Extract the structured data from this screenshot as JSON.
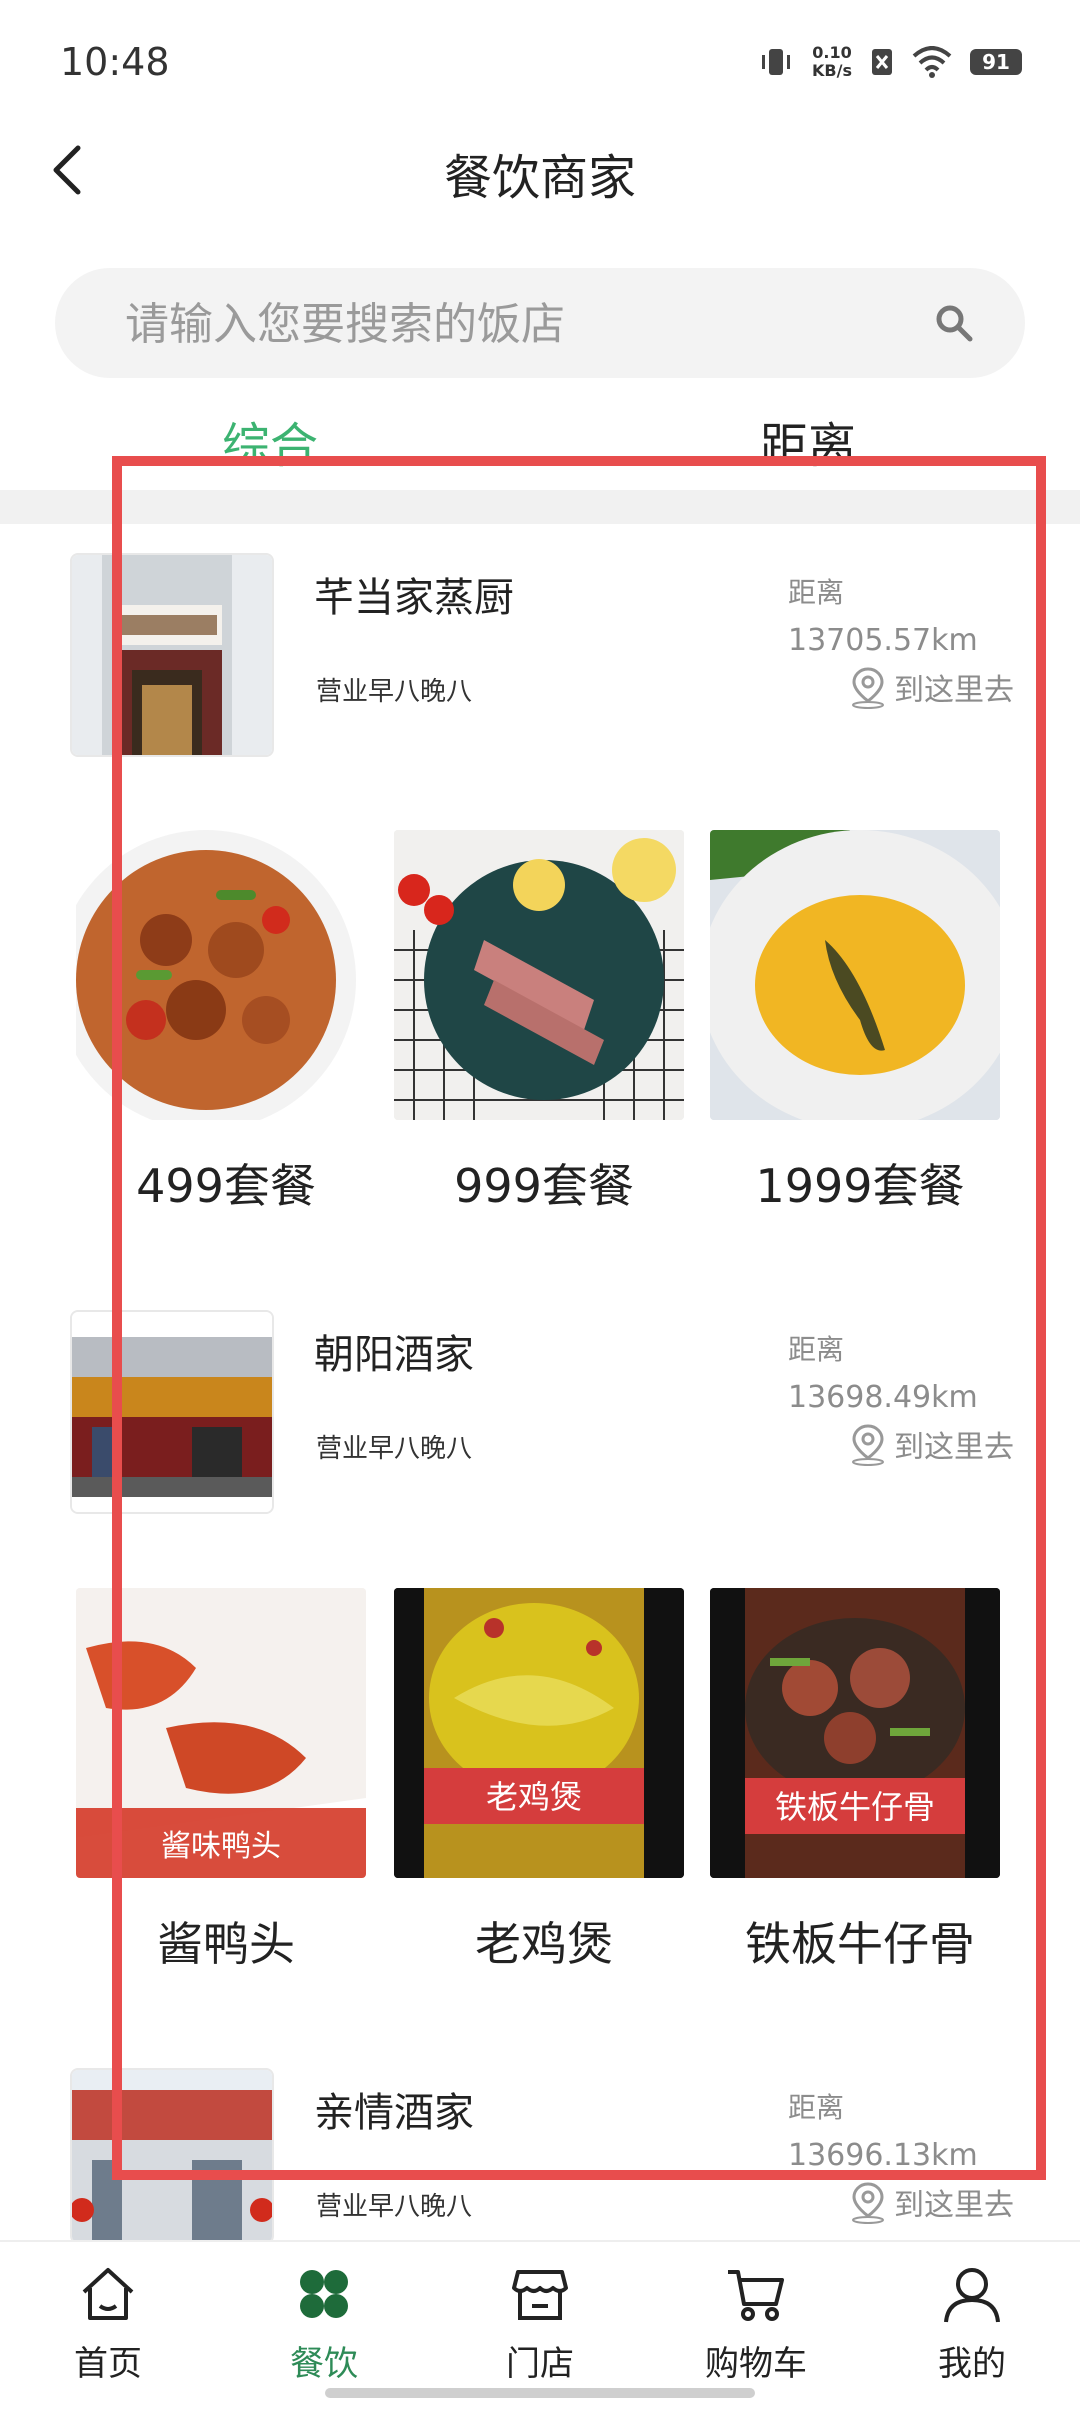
{
  "status": {
    "time": "10:48",
    "net_top": "0.10",
    "net_bottom": "KB/s",
    "battery": "91"
  },
  "header": {
    "title": "餐饮商家"
  },
  "search": {
    "placeholder": "请输入您要搜索的饭店"
  },
  "tabs": [
    {
      "label": "综合",
      "active": true
    },
    {
      "label": "距离",
      "active": false
    }
  ],
  "restaurants": [
    {
      "name": "芊当家蒸厨",
      "hours": "营业早八晚八",
      "distance_label": "距离",
      "distance": "13705.57km",
      "goto": "到这里去",
      "dishes": [
        {
          "name": "499套餐"
        },
        {
          "name": "999套餐"
        },
        {
          "name": "1999套餐"
        }
      ]
    },
    {
      "name": "朝阳酒家",
      "hours": "营业早八晚八",
      "distance_label": "距离",
      "distance": "13698.49km",
      "goto": "到这里去",
      "dishes": [
        {
          "name": "酱鸭头",
          "overlay": "酱味鸭头"
        },
        {
          "name": "老鸡煲",
          "overlay": "老鸡煲"
        },
        {
          "name": "铁板牛仔骨",
          "overlay": "铁板牛仔骨"
        }
      ]
    },
    {
      "name": "亲情酒家",
      "hours": "营业早八晚八",
      "distance_label": "距离",
      "distance": "13696.13km",
      "goto": "到这里去"
    }
  ],
  "nav": [
    {
      "label": "首页",
      "icon": "home-icon"
    },
    {
      "label": "餐饮",
      "icon": "clover-icon",
      "active": true
    },
    {
      "label": "门店",
      "icon": "store-icon"
    },
    {
      "label": "购物车",
      "icon": "cart-icon"
    },
    {
      "label": "我的",
      "icon": "user-icon"
    }
  ],
  "colors": {
    "accent": "#3cb371",
    "frame": "#e84d4d"
  }
}
